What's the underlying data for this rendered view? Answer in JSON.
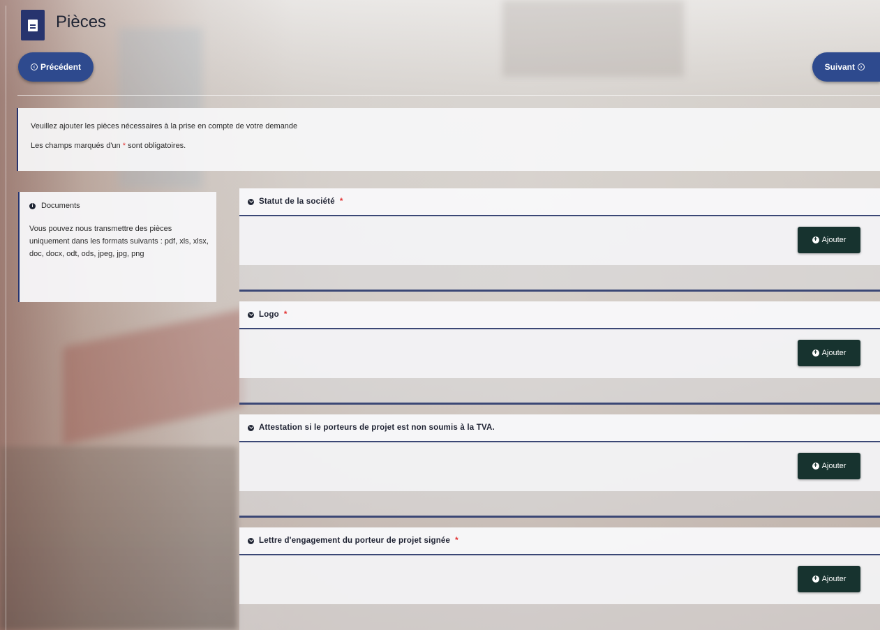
{
  "header": {
    "title": "Pièces",
    "prev_label": "Précédent",
    "next_label": "Suivant"
  },
  "info": {
    "line1": "Veuillez ajouter les pièces nécessaires à la prise en compte de votre demande",
    "line2_before": "Les champs marqués d'un",
    "required_mark": "*",
    "line2_after": "sont obligatoires."
  },
  "documents": {
    "title": "Documents",
    "text": "Vous pouvez nous transmettre des pièces uniquement dans les formats suivants : pdf, xls, xlsx, doc, docx, odt, ods, jpeg, jpg, png"
  },
  "sections": [
    {
      "title": "Statut de la société",
      "required": "*",
      "button": "Ajouter"
    },
    {
      "title": "Logo",
      "required": "*",
      "button": "Ajouter"
    },
    {
      "title": "Attestation si le porteurs de projet est non soumis à la TVA.",
      "required": "",
      "button": "Ajouter"
    },
    {
      "title": "Lettre d'engagement du porteur de projet signée",
      "required": "*",
      "button": "Ajouter"
    }
  ],
  "colors": {
    "primary": "#2e4a8e",
    "dark_navy": "#27346e",
    "add_button": "#17332f",
    "required": "#e23030"
  }
}
